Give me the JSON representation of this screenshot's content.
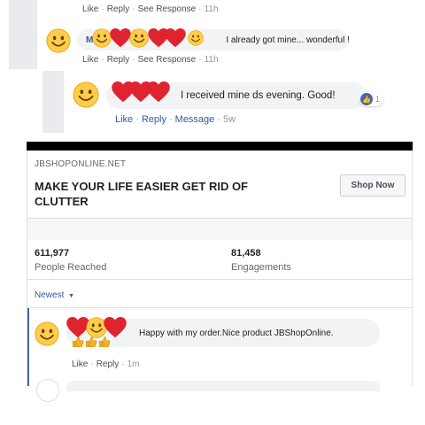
{
  "thread": {
    "action_like": "Like",
    "action_reply": "Reply",
    "action_see_response": "See Response",
    "action_message": "Message",
    "comment1": {
      "meta_above_time": "11h",
      "name_visible": "M",
      "text": "I already got mine... wonderful !",
      "time": "11h"
    },
    "comment2": {
      "text": "I received mine ds evening. Good!",
      "reaction_count": "1",
      "time": "5w"
    }
  },
  "ad": {
    "domain": "JBSHOPONLINE.NET",
    "headline": "MAKE YOUR LIFE EASIER GET RID OF CLUTTER",
    "cta_label": "Shop Now",
    "stats": {
      "reached_value": "611,977",
      "reached_label": "People Reached",
      "engagements_value": "81,458",
      "engagements_label": "Engagements"
    },
    "sort_label": "Newest",
    "comment": {
      "text": "Happy with my order.Nice product JBShopOnline.",
      "time": "1m"
    }
  },
  "colors": {
    "link_blue": "#365899",
    "like_blue": "#4267b2",
    "heart_red": "#e0242f",
    "emoji_yellow": "#ffcc4d"
  },
  "icons": {
    "redaction": "heart-icon",
    "avatar": "smiley-face-icon",
    "reaction": "thumbs-up-icon",
    "sort": "caret-down-icon"
  }
}
